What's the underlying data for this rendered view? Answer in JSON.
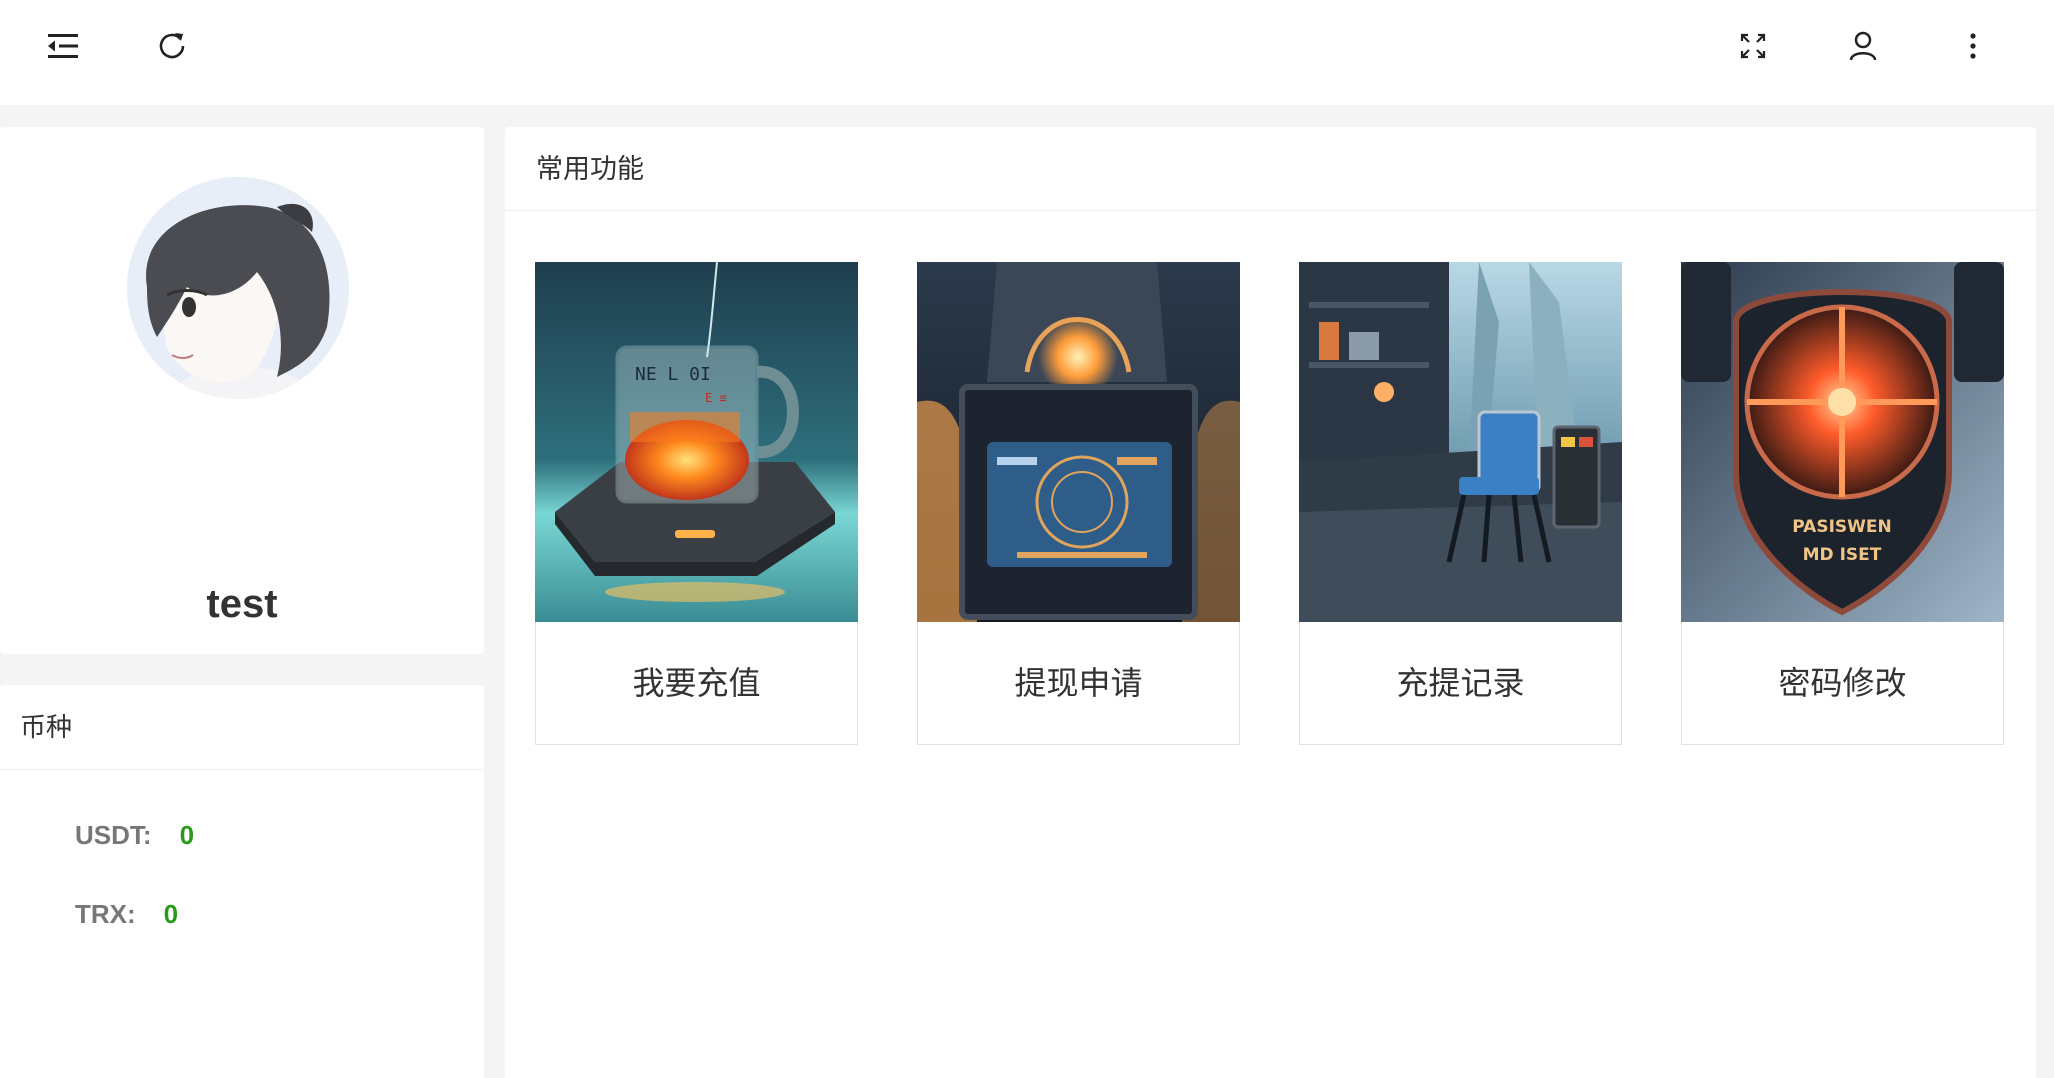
{
  "header": {
    "icons": [
      "menu-fold-icon",
      "refresh-icon",
      "fullscreen-icon",
      "user-icon",
      "more-vertical-icon"
    ]
  },
  "profile": {
    "username": "test",
    "email_redacted": true
  },
  "coins": {
    "title": "币种",
    "items": [
      {
        "label": "USDT:",
        "value": "0"
      },
      {
        "label": "TRX:",
        "value": "0"
      }
    ]
  },
  "functions": {
    "title": "常用功能",
    "tiles": [
      {
        "label": "我要充值",
        "image": "glowing-mug-illustration"
      },
      {
        "label": "提现申请",
        "image": "futuristic-console-illustration"
      },
      {
        "label": "充提记录",
        "image": "sci-fi-room-chair-illustration"
      },
      {
        "label": "密码修改",
        "image": "shield-emblem-illustration",
        "image_text": [
          "PASISWEN",
          "MD ISET"
        ]
      }
    ]
  },
  "colors": {
    "page_bg": "#f4f4f4",
    "card_bg": "#ffffff",
    "value_green": "#2a9a1a",
    "redaction_red": "#e8242a"
  }
}
